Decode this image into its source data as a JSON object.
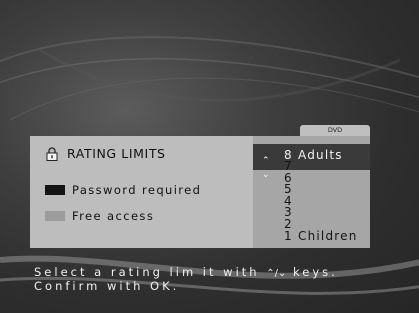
{
  "panel": {
    "title": "RATING LIMITS",
    "legend": [
      {
        "label": "Password required",
        "color": "#141414"
      },
      {
        "label": "Free access",
        "color": "#9c9c9c"
      }
    ]
  },
  "disc_tab": "DVD",
  "levels": [
    {
      "num": "8",
      "label": "Adults",
      "selected": true
    },
    {
      "num": "7",
      "label": ""
    },
    {
      "num": "6",
      "label": ""
    },
    {
      "num": "5",
      "label": ""
    },
    {
      "num": "4",
      "label": ""
    },
    {
      "num": "3",
      "label": ""
    },
    {
      "num": "2",
      "label": ""
    },
    {
      "num": "1",
      "label": "Children"
    }
  ],
  "instructions": {
    "line1_prefix": "Select a rating lim it with",
    "line1_keys": "⌃/⌄",
    "line1_suffix": "keys.",
    "line2": "Confirm with OK."
  },
  "colors": {
    "panel_bg": "#bdbdbd",
    "list_bg": "#a6a6a6",
    "highlight": "#3a3a3a"
  }
}
